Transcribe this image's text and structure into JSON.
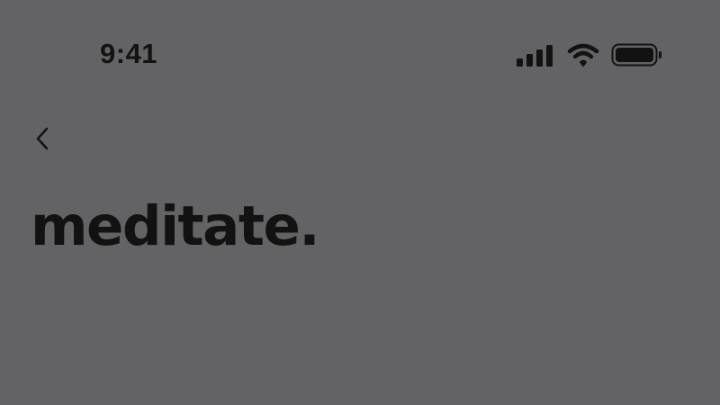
{
  "status_bar": {
    "time": "9:41",
    "icons": [
      "signal-icon",
      "wifi-icon",
      "battery-icon"
    ]
  },
  "navigation": {
    "back_icon": "chevron-left-icon"
  },
  "page": {
    "title": "meditate."
  },
  "colors": {
    "background": "#636264",
    "foreground": "#121212"
  }
}
